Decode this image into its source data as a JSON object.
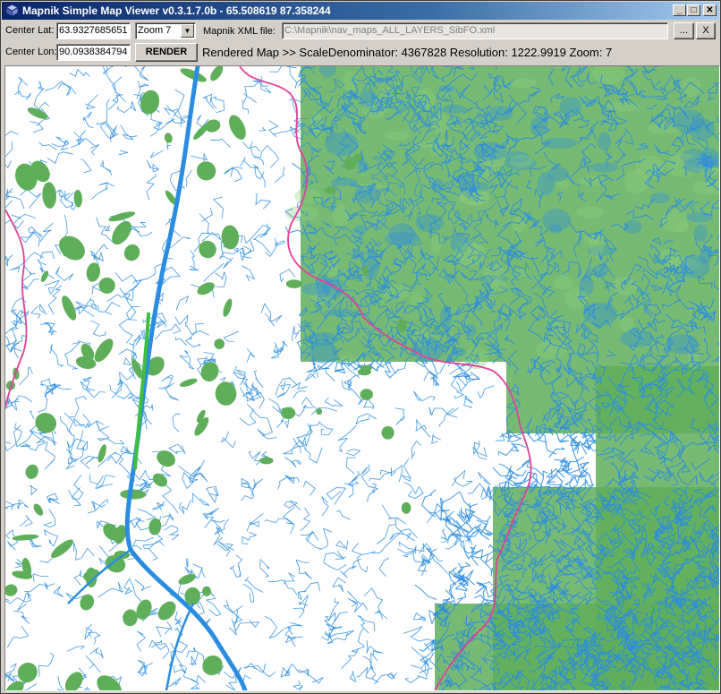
{
  "window": {
    "title": "Mapnik Simple Map Viewer v0.3.1.7.0b  -  65.508619  87.358244",
    "minimize_label": "_",
    "maximize_label": "□",
    "close_label": "✕"
  },
  "controls": {
    "center_lat_label": "Center Lat:",
    "center_lat_value": "63.9327685651",
    "center_lon_label": "Center Lon:",
    "center_lon_value": "90.0938384794",
    "zoom_selected": "Zoom 7",
    "render_label": "RENDER",
    "xml_label": "Mapnik XML file:",
    "xml_value": "C:\\Mapnik\\nav_maps_ALL_LAYERS_SibFO.xml",
    "browse_label": "...",
    "clear_label": "X",
    "status_text": "Rendered Map >> ScaleDenominator: 4367828 Resolution: 1222.9919 Zoom: 7"
  },
  "map": {
    "colors": {
      "water": "#2a8de0",
      "forest": "#5fae5a",
      "forest_light": "#8fcf7a",
      "boundary": "#e0409a",
      "background": "#ffffff"
    }
  }
}
